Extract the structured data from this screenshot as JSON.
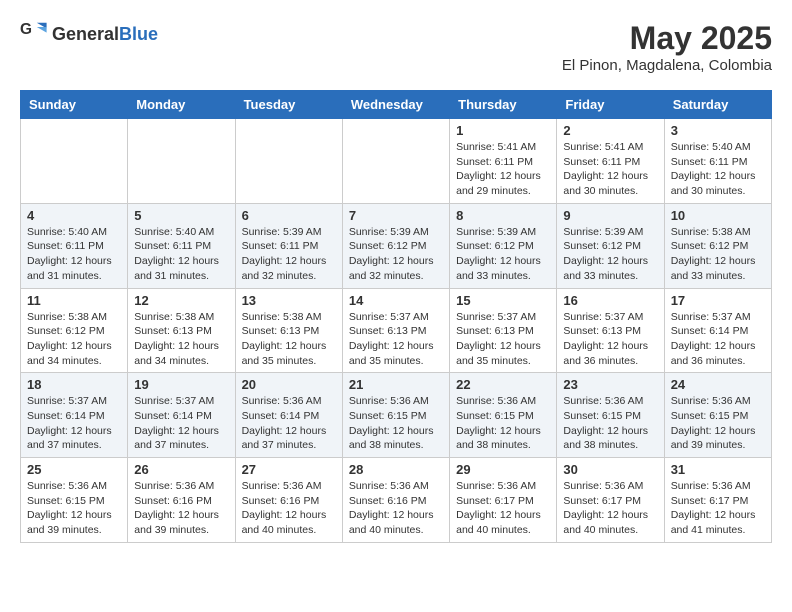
{
  "header": {
    "logo_general": "General",
    "logo_blue": "Blue",
    "title": "May 2025",
    "subtitle": "El Pinon, Magdalena, Colombia"
  },
  "weekdays": [
    "Sunday",
    "Monday",
    "Tuesday",
    "Wednesday",
    "Thursday",
    "Friday",
    "Saturday"
  ],
  "weeks": [
    {
      "rowClass": "row-odd",
      "days": [
        {
          "num": "",
          "info": ""
        },
        {
          "num": "",
          "info": ""
        },
        {
          "num": "",
          "info": ""
        },
        {
          "num": "",
          "info": ""
        },
        {
          "num": "1",
          "info": "Sunrise: 5:41 AM\nSunset: 6:11 PM\nDaylight: 12 hours\nand 29 minutes."
        },
        {
          "num": "2",
          "info": "Sunrise: 5:41 AM\nSunset: 6:11 PM\nDaylight: 12 hours\nand 30 minutes."
        },
        {
          "num": "3",
          "info": "Sunrise: 5:40 AM\nSunset: 6:11 PM\nDaylight: 12 hours\nand 30 minutes."
        }
      ]
    },
    {
      "rowClass": "row-even",
      "days": [
        {
          "num": "4",
          "info": "Sunrise: 5:40 AM\nSunset: 6:11 PM\nDaylight: 12 hours\nand 31 minutes."
        },
        {
          "num": "5",
          "info": "Sunrise: 5:40 AM\nSunset: 6:11 PM\nDaylight: 12 hours\nand 31 minutes."
        },
        {
          "num": "6",
          "info": "Sunrise: 5:39 AM\nSunset: 6:11 PM\nDaylight: 12 hours\nand 32 minutes."
        },
        {
          "num": "7",
          "info": "Sunrise: 5:39 AM\nSunset: 6:12 PM\nDaylight: 12 hours\nand 32 minutes."
        },
        {
          "num": "8",
          "info": "Sunrise: 5:39 AM\nSunset: 6:12 PM\nDaylight: 12 hours\nand 33 minutes."
        },
        {
          "num": "9",
          "info": "Sunrise: 5:39 AM\nSunset: 6:12 PM\nDaylight: 12 hours\nand 33 minutes."
        },
        {
          "num": "10",
          "info": "Sunrise: 5:38 AM\nSunset: 6:12 PM\nDaylight: 12 hours\nand 33 minutes."
        }
      ]
    },
    {
      "rowClass": "row-odd",
      "days": [
        {
          "num": "11",
          "info": "Sunrise: 5:38 AM\nSunset: 6:12 PM\nDaylight: 12 hours\nand 34 minutes."
        },
        {
          "num": "12",
          "info": "Sunrise: 5:38 AM\nSunset: 6:13 PM\nDaylight: 12 hours\nand 34 minutes."
        },
        {
          "num": "13",
          "info": "Sunrise: 5:38 AM\nSunset: 6:13 PM\nDaylight: 12 hours\nand 35 minutes."
        },
        {
          "num": "14",
          "info": "Sunrise: 5:37 AM\nSunset: 6:13 PM\nDaylight: 12 hours\nand 35 minutes."
        },
        {
          "num": "15",
          "info": "Sunrise: 5:37 AM\nSunset: 6:13 PM\nDaylight: 12 hours\nand 35 minutes."
        },
        {
          "num": "16",
          "info": "Sunrise: 5:37 AM\nSunset: 6:13 PM\nDaylight: 12 hours\nand 36 minutes."
        },
        {
          "num": "17",
          "info": "Sunrise: 5:37 AM\nSunset: 6:14 PM\nDaylight: 12 hours\nand 36 minutes."
        }
      ]
    },
    {
      "rowClass": "row-even",
      "days": [
        {
          "num": "18",
          "info": "Sunrise: 5:37 AM\nSunset: 6:14 PM\nDaylight: 12 hours\nand 37 minutes."
        },
        {
          "num": "19",
          "info": "Sunrise: 5:37 AM\nSunset: 6:14 PM\nDaylight: 12 hours\nand 37 minutes."
        },
        {
          "num": "20",
          "info": "Sunrise: 5:36 AM\nSunset: 6:14 PM\nDaylight: 12 hours\nand 37 minutes."
        },
        {
          "num": "21",
          "info": "Sunrise: 5:36 AM\nSunset: 6:15 PM\nDaylight: 12 hours\nand 38 minutes."
        },
        {
          "num": "22",
          "info": "Sunrise: 5:36 AM\nSunset: 6:15 PM\nDaylight: 12 hours\nand 38 minutes."
        },
        {
          "num": "23",
          "info": "Sunrise: 5:36 AM\nSunset: 6:15 PM\nDaylight: 12 hours\nand 38 minutes."
        },
        {
          "num": "24",
          "info": "Sunrise: 5:36 AM\nSunset: 6:15 PM\nDaylight: 12 hours\nand 39 minutes."
        }
      ]
    },
    {
      "rowClass": "row-odd",
      "days": [
        {
          "num": "25",
          "info": "Sunrise: 5:36 AM\nSunset: 6:15 PM\nDaylight: 12 hours\nand 39 minutes."
        },
        {
          "num": "26",
          "info": "Sunrise: 5:36 AM\nSunset: 6:16 PM\nDaylight: 12 hours\nand 39 minutes."
        },
        {
          "num": "27",
          "info": "Sunrise: 5:36 AM\nSunset: 6:16 PM\nDaylight: 12 hours\nand 40 minutes."
        },
        {
          "num": "28",
          "info": "Sunrise: 5:36 AM\nSunset: 6:16 PM\nDaylight: 12 hours\nand 40 minutes."
        },
        {
          "num": "29",
          "info": "Sunrise: 5:36 AM\nSunset: 6:17 PM\nDaylight: 12 hours\nand 40 minutes."
        },
        {
          "num": "30",
          "info": "Sunrise: 5:36 AM\nSunset: 6:17 PM\nDaylight: 12 hours\nand 40 minutes."
        },
        {
          "num": "31",
          "info": "Sunrise: 5:36 AM\nSunset: 6:17 PM\nDaylight: 12 hours\nand 41 minutes."
        }
      ]
    }
  ]
}
